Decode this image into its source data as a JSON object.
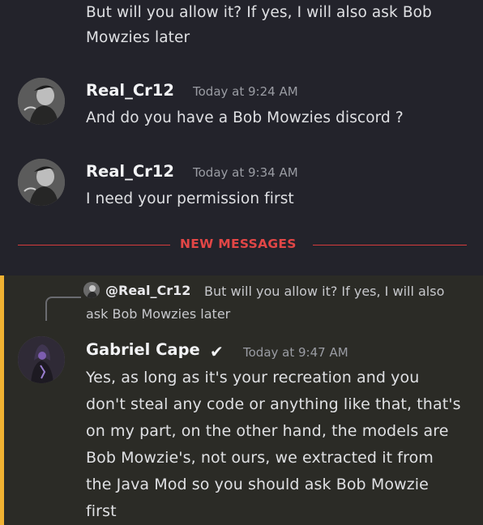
{
  "messages_top": {
    "continued_line1": "But will you allow it? If yes, I will also ask Bob",
    "continued_line2": "Mowzies later",
    "msg1": {
      "author": "Real_Cr12",
      "time": "Today at 9:24 AM",
      "text": "And do you have a Bob Mowzies discord ?"
    },
    "msg2": {
      "author": "Real_Cr12",
      "time": "Today at 9:34 AM",
      "text": "I need your permission first"
    }
  },
  "divider": {
    "label": "NEW MESSAGES"
  },
  "reply": {
    "author": "@Real_Cr12",
    "text_line1": "But will you allow it? If yes, I will also",
    "text_line2": "ask Bob Mowzies later"
  },
  "msg3": {
    "author": "Gabriel Cape",
    "badge": "✔",
    "time": "Today at 9:47 AM",
    "lines": [
      "Yes, as long as it's your recreation and you",
      "don't steal any code or anything like that, that's",
      "on my part, on the other hand, the models are",
      "Bob Mowzie's, not ours, we extracted it from",
      "the Java Mod so you should ask Bob Mowzie",
      "first"
    ]
  },
  "colors": {
    "divider": "#d43c3c",
    "mention_bar": "#f0b232",
    "top_bg": "#23232b",
    "bottom_bg": "#2b2b26"
  }
}
